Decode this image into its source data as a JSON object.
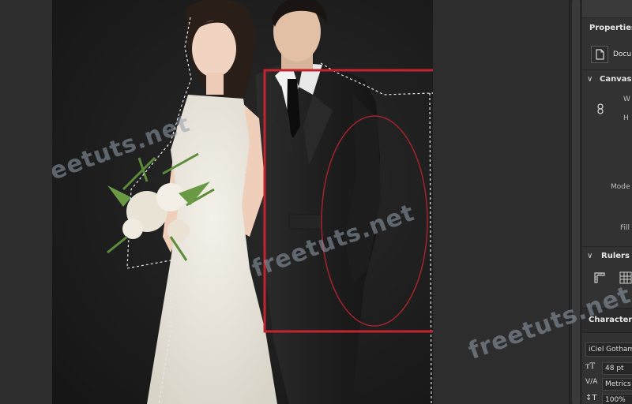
{
  "watermarks": [
    "freetuts.net",
    "freetuts.net",
    "freetuts.net"
  ],
  "panel": {
    "properties_title": "Properties",
    "document_label": "Docu",
    "canvas_section": "Canvas",
    "w_label": "W",
    "h_label": "H",
    "mode_label": "Mode",
    "fill_label": "Fill",
    "rulers_section": "Rulers &",
    "character_tab": "Character",
    "font_family": "iCiel Gotham",
    "font_size": "48 pt",
    "kerning": "Metrics",
    "leading": "100%"
  },
  "colors": {
    "selection_rect": "#c4242e",
    "ellipse": "#a3242b",
    "panel_bg": "#323232",
    "canvas_bg": "#1e1e1e"
  },
  "icons": [
    "document-icon",
    "link-chain-icon",
    "ruler-icon",
    "grid-icon",
    "font-size-icon",
    "kerning-icon",
    "leading-icon",
    "collapse-chevron-icon"
  ]
}
